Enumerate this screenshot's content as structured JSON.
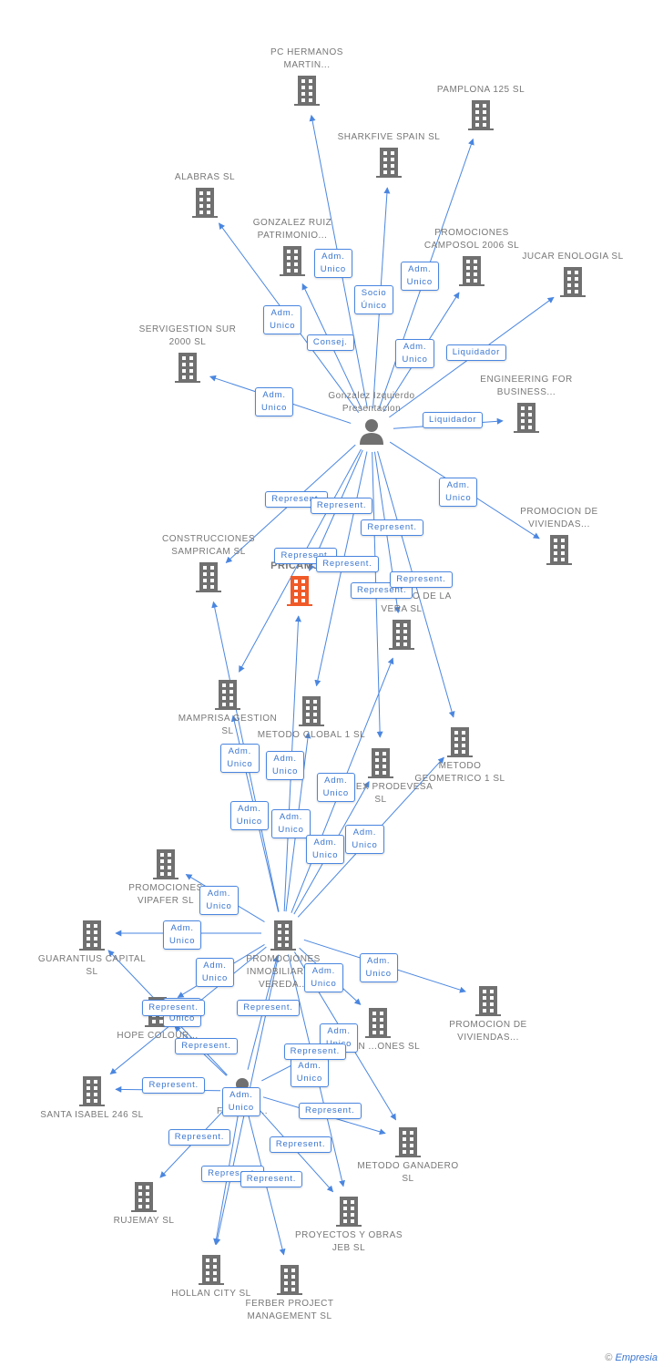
{
  "colors": {
    "edge": "#4a86e0",
    "company": "#707070",
    "focus": "#f05a28",
    "person": "#707070"
  },
  "nodes": [
    {
      "id": "pc",
      "type": "company",
      "label": "PC HERMANOS MARTIN..."
    },
    {
      "id": "pamplona",
      "type": "company",
      "label": "PAMPLONA 125 SL"
    },
    {
      "id": "sharkfive",
      "type": "company",
      "label": "SHARKFIVE SPAIN SL"
    },
    {
      "id": "alabras",
      "type": "company",
      "label": "ALABRAS SL"
    },
    {
      "id": "gruiz",
      "type": "company",
      "label": "GONZALEZ RUIZ PATRIMONIO..."
    },
    {
      "id": "camposol",
      "type": "company",
      "label": "PROMOCIONES CAMPOSOL 2006 SL"
    },
    {
      "id": "jucar",
      "type": "company",
      "label": "JUCAR ENOLOGIA SL"
    },
    {
      "id": "servigestion",
      "type": "company",
      "label": "SERVIGESTION SUR 2000 SL"
    },
    {
      "id": "engineering",
      "type": "company",
      "label": "ENGINEERING FOR BUSINESS..."
    },
    {
      "id": "person1",
      "type": "person",
      "label": "Gonzalez Izquierdo Presentacion"
    },
    {
      "id": "promviv1",
      "type": "company",
      "label": "PROMOCION DE VIVIENDAS..."
    },
    {
      "id": "construcciones",
      "type": "company",
      "label": "CONSTRUCCIONES SAMPRICAM SL"
    },
    {
      "id": "pricamj",
      "type": "focus",
      "label": "PRICAMJ..."
    },
    {
      "id": "ecologico",
      "type": "company",
      "label": "...ECOLOGICO DE LA VERA SL"
    },
    {
      "id": "mamprisa",
      "type": "company",
      "label": "MAMPRISA GESTION SL"
    },
    {
      "id": "mglobal",
      "type": "company",
      "label": "METODO GLOBAL 1 SL"
    },
    {
      "id": "nortex",
      "type": "company",
      "label": "NORTEX PRODEVESA SL"
    },
    {
      "id": "mgeometrico",
      "type": "company",
      "label": "METODO GEOMETRICO 1 SL"
    },
    {
      "id": "vipafer",
      "type": "company",
      "label": "PROMOCIONES VIPAFER SL"
    },
    {
      "id": "guarantius",
      "type": "company",
      "label": "GUARANTIUS CAPITAL SL"
    },
    {
      "id": "vereda",
      "type": "company",
      "label": "PROMOCIONES INMOBILIARIAS VEREDA..."
    },
    {
      "id": "promviv2",
      "type": "company",
      "label": "PROMOCION DE VIVIENDAS..."
    },
    {
      "id": "hope",
      "type": "company",
      "label": "HOPE COLOUR..."
    },
    {
      "id": "ran",
      "type": "company",
      "label": "...RAN ...ONES SL"
    },
    {
      "id": "santa",
      "type": "company",
      "label": "SANTA ISABEL 246 SL"
    },
    {
      "id": "person2",
      "type": "person",
      "label": "F... Angel..."
    },
    {
      "id": "mganadero",
      "type": "company",
      "label": "METODO GANADERO SL"
    },
    {
      "id": "rujemay",
      "type": "company",
      "label": "RUJEMAY SL"
    },
    {
      "id": "proyectos",
      "type": "company",
      "label": "PROYECTOS Y OBRAS JEB SL"
    },
    {
      "id": "hollan",
      "type": "company",
      "label": "HOLLAN CITY SL"
    },
    {
      "id": "ferber",
      "type": "company",
      "label": "FERBER PROJECT MANAGEMENT SL"
    }
  ],
  "edges": [
    {
      "from": "person1",
      "to": "pc",
      "label": "Adm.\nUnico"
    },
    {
      "from": "person1",
      "to": "sharkfive",
      "label": "Socio\nÚnico"
    },
    {
      "from": "person1",
      "to": "pamplona",
      "label": "Adm.\nUnico"
    },
    {
      "from": "person1",
      "to": "alabras",
      "label": "Adm.\nUnico"
    },
    {
      "from": "person1",
      "to": "gruiz",
      "label": "Consej."
    },
    {
      "from": "person1",
      "to": "camposol",
      "label": "Adm.\nUnico"
    },
    {
      "from": "person1",
      "to": "jucar",
      "label": "Liquidador"
    },
    {
      "from": "person1",
      "to": "servigestion",
      "label": "Adm.\nUnico"
    },
    {
      "from": "person1",
      "to": "engineering",
      "label": "Liquidador"
    },
    {
      "from": "person1",
      "to": "promviv1",
      "label": "Adm.\nUnico"
    },
    {
      "from": "person1",
      "to": "construcciones",
      "label": "Represent."
    },
    {
      "from": "person1",
      "to": "mamprisa",
      "label": "Represent."
    },
    {
      "from": "person1",
      "to": "mglobal",
      "label": "Represent."
    },
    {
      "from": "person1",
      "to": "pricamj",
      "label": "Represent."
    },
    {
      "from": "person1",
      "to": "ecologico",
      "label": "Represent."
    },
    {
      "from": "person1",
      "to": "nortex",
      "label": "Represent."
    },
    {
      "from": "person1",
      "to": "mgeometrico",
      "label": "Represent."
    },
    {
      "from": "vereda",
      "to": "mamprisa",
      "label": "Adm.\nUnico"
    },
    {
      "from": "vereda",
      "to": "pricamj",
      "label": "Adm.\nUnico"
    },
    {
      "from": "vereda",
      "to": "ecologico",
      "label": "Adm.\nUnico"
    },
    {
      "from": "vereda",
      "to": "construcciones",
      "label": "Adm.\nUnico"
    },
    {
      "from": "vereda",
      "to": "mglobal",
      "label": "Adm.\nUnico"
    },
    {
      "from": "vereda",
      "to": "nortex",
      "label": "Adm.\nUnico"
    },
    {
      "from": "vereda",
      "to": "mgeometrico",
      "label": "Adm.\nUnico"
    },
    {
      "from": "vereda",
      "to": "vipafer",
      "label": "Adm.\nUnico"
    },
    {
      "from": "vereda",
      "to": "guarantius",
      "label": "Adm.\nUnico"
    },
    {
      "from": "vereda",
      "to": "promviv2",
      "label": "Adm.\nUnico"
    },
    {
      "from": "vereda",
      "to": "ran",
      "label": "Adm.\nUnico"
    },
    {
      "from": "vereda",
      "to": "hope",
      "label": "Adm.\nUnico"
    },
    {
      "from": "vereda",
      "to": "mganadero",
      "label": "Adm.\nUnico"
    },
    {
      "from": "vereda",
      "to": "santa",
      "label": "Adm.\nUnico"
    },
    {
      "from": "vereda",
      "to": "proyectos",
      "label": "Adm.\nUnico"
    },
    {
      "from": "vereda",
      "to": "hollan",
      "label": "Adm.\nUnico"
    },
    {
      "from": "person2",
      "to": "guarantius",
      "label": "Represent."
    },
    {
      "from": "person2",
      "to": "hope",
      "label": "Represent."
    },
    {
      "from": "person2",
      "to": "vereda",
      "label": "Represent."
    },
    {
      "from": "person2",
      "to": "santa",
      "label": "Represent."
    },
    {
      "from": "person2",
      "to": "ran",
      "label": "Represent."
    },
    {
      "from": "person2",
      "to": "mganadero",
      "label": "Represent."
    },
    {
      "from": "person2",
      "to": "rujemay",
      "label": "Represent."
    },
    {
      "from": "person2",
      "to": "proyectos",
      "label": "Represent."
    },
    {
      "from": "person2",
      "to": "hollan",
      "label": "Represent."
    },
    {
      "from": "person2",
      "to": "ferber",
      "label": "Represent."
    }
  ],
  "footer": {
    "copyright": "©",
    "brand": "Empresia"
  }
}
